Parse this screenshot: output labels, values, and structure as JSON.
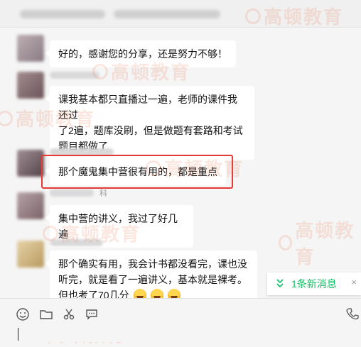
{
  "watermark": {
    "text": "高顿教育"
  },
  "messages": [
    {
      "id": "m1",
      "text": "好的，感谢您的分享，还是努力不够！"
    },
    {
      "id": "m2",
      "lines": [
        "课我基本都只直播过一遍，老师的课件我还过",
        "了2遍，题库没刷，但是做题有套路和考试",
        "题目都做了"
      ]
    },
    {
      "id": "m3",
      "text": "那个魔鬼集中营很有用的，都是重点"
    },
    {
      "id": "m4",
      "text": "集中营的讲义，我过了好几遍"
    },
    {
      "id": "m5",
      "lines": [
        "那个确实有用，我会计书都没看完，课也没",
        "听完，就是看了一遍讲义，基本就是裸考。",
        "但也考了70几分"
      ]
    }
  ],
  "sender_partial": "科",
  "new_message_toast": {
    "label": "1条新消息",
    "icon": "chevron-down-double-icon"
  },
  "toolbar": {
    "icons": [
      "emoji-icon",
      "folder-icon",
      "scissors-icon",
      "chat-bubble-icon",
      "phone-icon"
    ]
  },
  "colors": {
    "accent_green": "#07c160",
    "highlight_red": "#e53935"
  }
}
